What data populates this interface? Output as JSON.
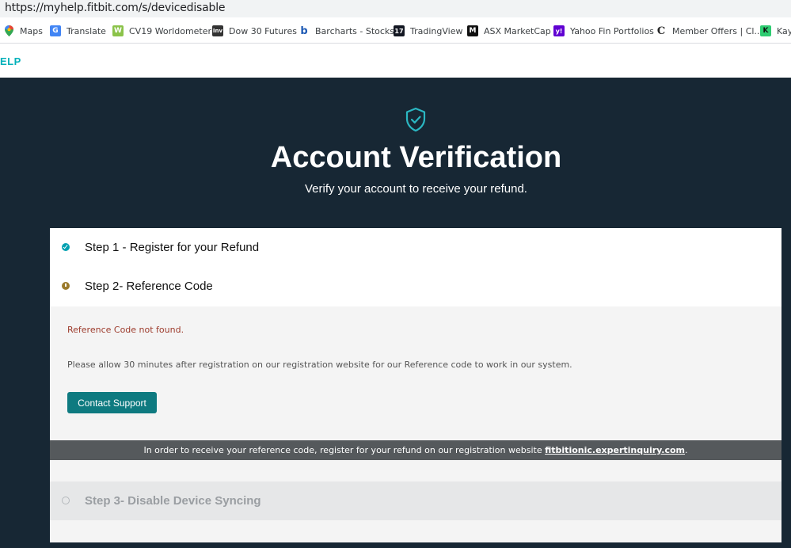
{
  "browser": {
    "url": "https://myhelp.fitbit.com/s/devicedisable",
    "bookmarks": [
      {
        "label": "Maps",
        "icon": "maps-pin-icon"
      },
      {
        "label": "Translate",
        "icon": "translate-icon"
      },
      {
        "label": "CV19 Worldometer",
        "icon": "worldometer-icon"
      },
      {
        "label": "Dow 30 Futures",
        "icon": "investing-icon"
      },
      {
        "label": "Barcharts - Stocks",
        "icon": "barchart-icon"
      },
      {
        "label": "TradingView",
        "icon": "tradingview-icon"
      },
      {
        "label": "ASX MarketCap",
        "icon": "marketcap-icon"
      },
      {
        "label": "Yahoo Fin Portfolios",
        "icon": "yahoo-icon"
      },
      {
        "label": "Member Offers | Cl...",
        "icon": "member-offers-icon"
      },
      {
        "label": "Kay",
        "icon": "k-icon"
      }
    ]
  },
  "site": {
    "logo_text": "ELP"
  },
  "hero": {
    "icon": "shield-check-icon",
    "title": "Account Verification",
    "subtitle": "Verify your account to receive your refund."
  },
  "steps": {
    "step1": {
      "label": "Step 1 - Register for your Refund",
      "state": "complete"
    },
    "step2": {
      "label": "Step 2- Reference Code",
      "state": "warning"
    },
    "step3": {
      "label": "Step 3- Disable Device Syncing",
      "state": "pending"
    }
  },
  "panel": {
    "error": "Reference Code not found.",
    "info": "Please allow 30 minutes after registration on our registration website for our Reference code to work in our system.",
    "button_label": "Contact Support"
  },
  "banner": {
    "text": "In order to receive your reference code, register for your refund on our registration website ",
    "link": "fitbitionic.expertinquiry.com",
    "suffix": "."
  },
  "colors": {
    "hero_bg": "#172734",
    "accent": "#00a0b0",
    "button": "#0e7a80",
    "error": "#9d3b2c",
    "banner_bg": "#55595c"
  }
}
